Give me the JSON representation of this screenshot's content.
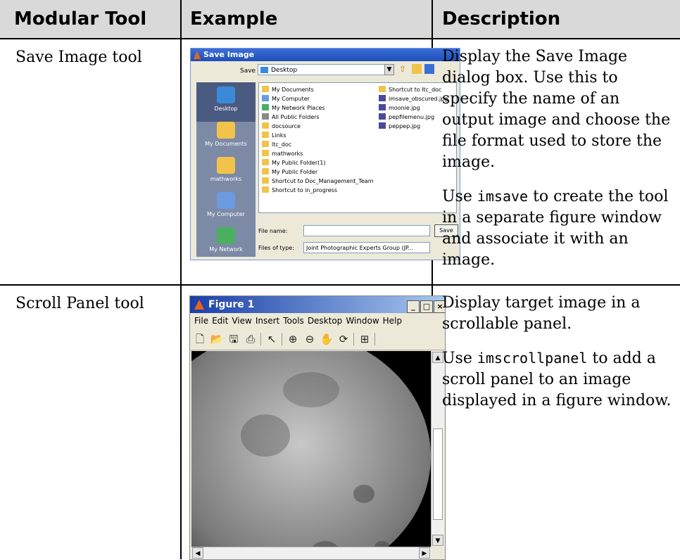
{
  "table": {
    "headers": [
      "Modular Tool",
      "Example",
      "Description"
    ],
    "rows": [
      {
        "tool": "Save Image tool",
        "desc_p1": "Display the Save Image dialog box. Use this to specify the name of an output image and choose the file format used to store the image.",
        "desc_p2_pre": "Use ",
        "desc_p2_code": "imsave",
        "desc_p2_post": " to create the tool in a separate figure window and associate it with an image."
      },
      {
        "tool": "Scroll Panel tool",
        "desc_p1": "Display target image in a scrollable panel.",
        "desc_p2_pre": "Use ",
        "desc_p2_code": "imscrollpanel",
        "desc_p2_post": " to add a scroll panel to an image displayed in a figure window."
      }
    ]
  },
  "save_dialog": {
    "title": "Save Image",
    "save_in_label": "Save in:",
    "save_in_value": "Desktop",
    "places": [
      "Desktop",
      "My Documents",
      "mathworks",
      "My Computer",
      "My Network"
    ],
    "files_col1": [
      "My Documents",
      "My Computer",
      "My Network Places",
      "All Public Folders",
      "docsource",
      "Links",
      "ltc_doc",
      "mathworks",
      "My Public Folder(1)",
      "My Public Folder",
      "Shortcut to Doc_Management_Team",
      "Shortcut to in_progress"
    ],
    "files_col2": [
      "Shortcut to ltc_doc",
      "imsave_obscured.jpg",
      "moonie.jpg",
      "pepfilemenu.jpg",
      "peppep.jpg"
    ],
    "file_name_label": "File name:",
    "file_name_value": "",
    "file_type_label": "Files of type:",
    "file_type_value": "Joint Photographic Experts Group (JP...",
    "save_button": "Save"
  },
  "figure_window": {
    "title": "Figure 1",
    "menu": [
      "File",
      "Edit",
      "View",
      "Insert",
      "Tools",
      "Desktop",
      "Window",
      "Help"
    ],
    "minimize": "_",
    "maximize": "□",
    "close": "×"
  },
  "colors": {
    "header_bg": "#d9d9d9",
    "xp_title_blue": "#2f5fcc",
    "dialog_bg": "#ece9d8"
  }
}
